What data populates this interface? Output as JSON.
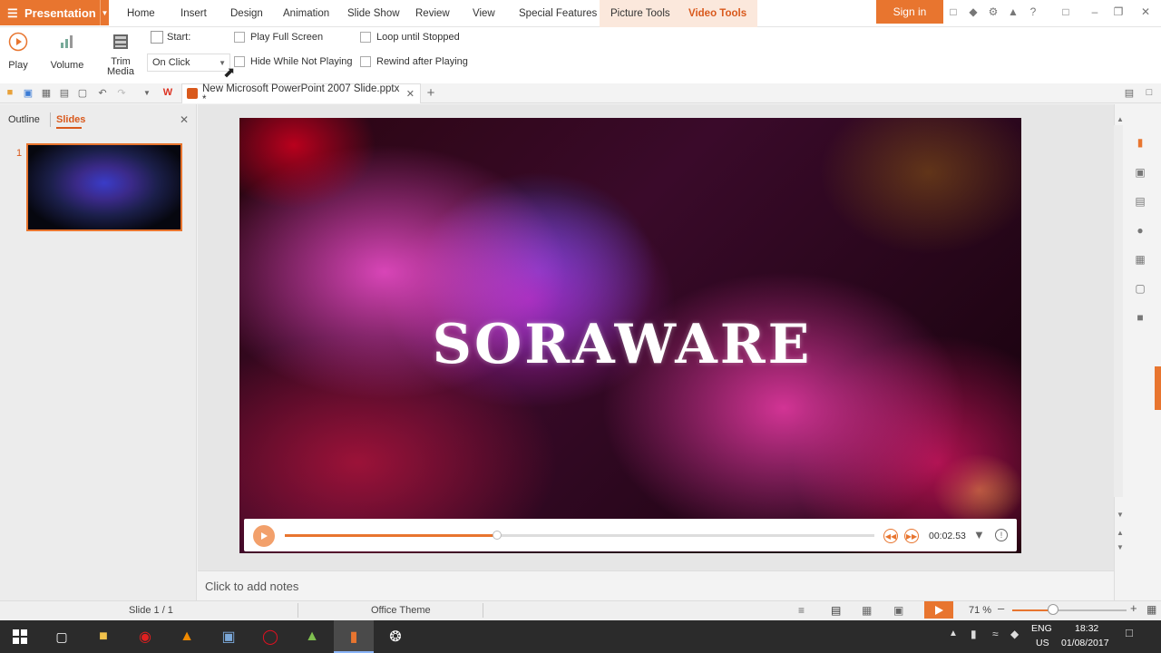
{
  "app": {
    "name": "Presentation",
    "signin": "Sign in"
  },
  "menus": [
    "Home",
    "Insert",
    "Design",
    "Animation",
    "Slide Show",
    "Review",
    "View",
    "Special Features",
    "Picture Tools",
    "Video Tools"
  ],
  "ribbon": {
    "play": "Play",
    "volume": "Volume",
    "trim_line1": "Trim",
    "trim_line2": "Media",
    "start_label": "Start:",
    "start_value": "On Click",
    "play_full_screen": "Play Full Screen",
    "hide_while_not_playing": "Hide While Not Playing",
    "loop_until_stopped": "Loop until Stopped",
    "rewind_after_playing": "Rewind after Playing"
  },
  "document": {
    "tab_title": "New Microsoft PowerPoint 2007 Slide.pptx *"
  },
  "panel": {
    "outline": "Outline",
    "slides": "Slides",
    "slide_number": "1"
  },
  "slide": {
    "title": "SORAWARE"
  },
  "player": {
    "time": "00:02.53",
    "progress": 0.36
  },
  "notes": {
    "placeholder": "Click to add notes"
  },
  "status": {
    "slide": "Slide 1 / 1",
    "theme": "Office Theme",
    "zoom": "71 %",
    "zoom_level": 0.36
  },
  "taskbar": {
    "lang1": "ENG",
    "lang2": "US",
    "time": "18:32",
    "date": "01/08/2017"
  },
  "colors": {
    "accent": "#e8752f",
    "active_tab": "#d9591c"
  }
}
